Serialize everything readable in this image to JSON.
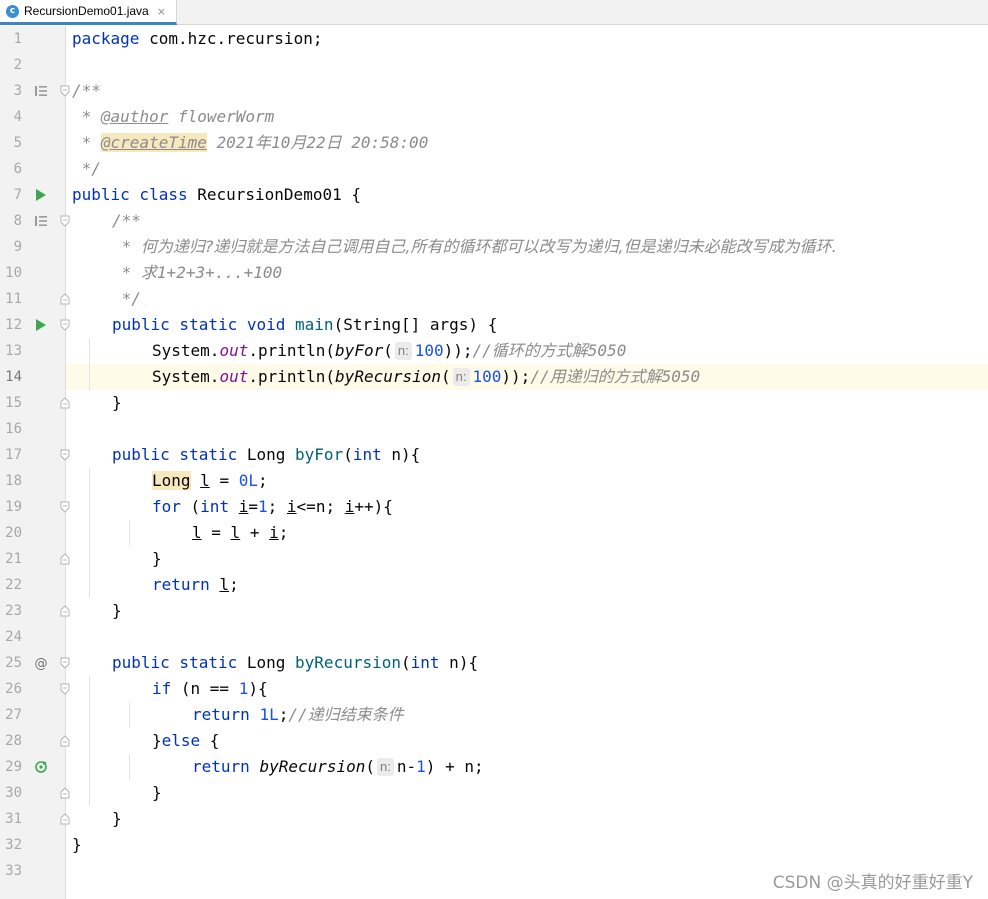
{
  "tab": {
    "file_name": "RecursionDemo01.java",
    "icon": "java-class-icon",
    "close_glyph": "×"
  },
  "editor": {
    "current_line": 14,
    "lines": [
      {
        "n": "1",
        "indent": 0,
        "tokens": [
          [
            "kw",
            "package"
          ],
          [
            "t",
            " com.hzc.recursion;"
          ]
        ]
      },
      {
        "n": "2",
        "indent": 0,
        "tokens": []
      },
      {
        "n": "3",
        "indent": 0,
        "marker": "doc",
        "fold": "start",
        "tokens": [
          [
            "doc",
            "/**"
          ]
        ]
      },
      {
        "n": "4",
        "indent": 0,
        "tokens": [
          [
            "doc",
            " * "
          ],
          [
            "tag",
            "@author"
          ],
          [
            "doc",
            " flowerWorm"
          ]
        ]
      },
      {
        "n": "5",
        "indent": 0,
        "tokens": [
          [
            "doc",
            " * "
          ],
          [
            "tag-hl",
            "@createTime"
          ],
          [
            "doc",
            " 2021"
          ],
          [
            "doc cjk",
            "年"
          ],
          [
            "doc",
            "10"
          ],
          [
            "doc cjk",
            "月"
          ],
          [
            "doc",
            "22"
          ],
          [
            "doc cjk",
            "日"
          ],
          [
            "doc",
            " 20:58:00"
          ]
        ]
      },
      {
        "n": "6",
        "indent": 0,
        "tokens": [
          [
            "doc",
            " */"
          ]
        ]
      },
      {
        "n": "7",
        "indent": 0,
        "marker": "run",
        "tokens": [
          [
            "kw",
            "public class"
          ],
          [
            "t",
            " RecursionDemo01 {"
          ]
        ]
      },
      {
        "n": "8",
        "indent": 1,
        "marker": "doc",
        "fold": "start",
        "tokens": [
          [
            "doc",
            "/**"
          ]
        ]
      },
      {
        "n": "9",
        "indent": 1,
        "tokens": [
          [
            "doc",
            " * "
          ],
          [
            "doc cjk",
            "何为递归?递归就是方法自己调用自己,所有的循环都可以改写为递归,但是递归未必能改写成为循环."
          ]
        ]
      },
      {
        "n": "10",
        "indent": 1,
        "tokens": [
          [
            "doc",
            " * "
          ],
          [
            "doc cjk",
            "求"
          ],
          [
            "doc",
            "1+2+3+...+100"
          ]
        ]
      },
      {
        "n": "11",
        "indent": 1,
        "fold": "end",
        "tokens": [
          [
            "doc",
            " */"
          ]
        ]
      },
      {
        "n": "12",
        "indent": 1,
        "marker": "run",
        "fold": "start",
        "tokens": [
          [
            "kw",
            "public static void"
          ],
          [
            "t",
            " "
          ],
          [
            "meth",
            "main"
          ],
          [
            "t",
            "(String[] args) {"
          ]
        ]
      },
      {
        "n": "13",
        "indent": 2,
        "tokens": [
          [
            "t",
            "System."
          ],
          [
            "static",
            "out"
          ],
          [
            "t",
            ".println("
          ],
          [
            "ital",
            "byFor"
          ],
          [
            "t",
            "("
          ],
          [
            "hint",
            "n:"
          ],
          [
            "num",
            "100"
          ],
          [
            "t",
            "));"
          ],
          [
            "cmt",
            "//"
          ],
          [
            "cmt cjk",
            "循环的方式解"
          ],
          [
            "cmt",
            "5050"
          ]
        ]
      },
      {
        "n": "14",
        "indent": 2,
        "tokens": [
          [
            "t",
            "System."
          ],
          [
            "static",
            "out"
          ],
          [
            "t",
            ".println("
          ],
          [
            "ital",
            "byRecursion"
          ],
          [
            "t",
            "("
          ],
          [
            "hint",
            "n:"
          ],
          [
            "num",
            "100"
          ],
          [
            "t",
            "));"
          ],
          [
            "cmt",
            "//"
          ],
          [
            "cmt cjk",
            "用递归的方式解"
          ],
          [
            "cmt",
            "5050"
          ]
        ]
      },
      {
        "n": "15",
        "indent": 1,
        "fold": "end",
        "tokens": [
          [
            "t",
            "}"
          ]
        ]
      },
      {
        "n": "16",
        "indent": 0,
        "tokens": []
      },
      {
        "n": "17",
        "indent": 1,
        "fold": "start",
        "tokens": [
          [
            "kw",
            "public static"
          ],
          [
            "t",
            " Long "
          ],
          [
            "meth",
            "byFor"
          ],
          [
            "t",
            "("
          ],
          [
            "kw",
            "int"
          ],
          [
            "t",
            " n){"
          ]
        ]
      },
      {
        "n": "18",
        "indent": 2,
        "tokens": [
          [
            "hlref",
            "Long"
          ],
          [
            "t",
            " "
          ],
          [
            "uline",
            "l"
          ],
          [
            "t",
            " = "
          ],
          [
            "num",
            "0L"
          ],
          [
            "t",
            ";"
          ]
        ]
      },
      {
        "n": "19",
        "indent": 2,
        "fold": "start",
        "tokens": [
          [
            "kw",
            "for"
          ],
          [
            "t",
            " ("
          ],
          [
            "kw",
            "int"
          ],
          [
            "t",
            " "
          ],
          [
            "uline",
            "i"
          ],
          [
            "t",
            "="
          ],
          [
            "num",
            "1"
          ],
          [
            "t",
            "; "
          ],
          [
            "uline",
            "i"
          ],
          [
            "t",
            "<=n; "
          ],
          [
            "uline",
            "i"
          ],
          [
            "t",
            "++){"
          ]
        ]
      },
      {
        "n": "20",
        "indent": 3,
        "tokens": [
          [
            "uline",
            "l"
          ],
          [
            "t",
            " = "
          ],
          [
            "uline",
            "l"
          ],
          [
            "t",
            " + "
          ],
          [
            "uline",
            "i"
          ],
          [
            "t",
            ";"
          ]
        ]
      },
      {
        "n": "21",
        "indent": 2,
        "fold": "end",
        "tokens": [
          [
            "t",
            "}"
          ]
        ]
      },
      {
        "n": "22",
        "indent": 2,
        "tokens": [
          [
            "kw",
            "return"
          ],
          [
            "t",
            " "
          ],
          [
            "uline",
            "l"
          ],
          [
            "t",
            ";"
          ]
        ]
      },
      {
        "n": "23",
        "indent": 1,
        "fold": "end",
        "tokens": [
          [
            "t",
            "}"
          ]
        ]
      },
      {
        "n": "24",
        "indent": 0,
        "tokens": []
      },
      {
        "n": "25",
        "indent": 1,
        "marker": "at",
        "fold": "start",
        "tokens": [
          [
            "kw",
            "public static"
          ],
          [
            "t",
            " Long "
          ],
          [
            "meth",
            "byRecursion"
          ],
          [
            "t",
            "("
          ],
          [
            "kw",
            "int"
          ],
          [
            "t",
            " n){"
          ]
        ]
      },
      {
        "n": "26",
        "indent": 2,
        "fold": "start",
        "tokens": [
          [
            "kw",
            "if"
          ],
          [
            "t",
            " (n == "
          ],
          [
            "num",
            "1"
          ],
          [
            "t",
            "){"
          ]
        ]
      },
      {
        "n": "27",
        "indent": 3,
        "tokens": [
          [
            "kw",
            "return"
          ],
          [
            "t",
            " "
          ],
          [
            "num",
            "1L"
          ],
          [
            "t",
            ";"
          ],
          [
            "cmt",
            "//"
          ],
          [
            "cmt cjk",
            "递归结束条件"
          ]
        ]
      },
      {
        "n": "28",
        "indent": 2,
        "fold": "mid",
        "tokens": [
          [
            "t",
            "}"
          ],
          [
            "kw",
            "else"
          ],
          [
            "t",
            " {"
          ]
        ]
      },
      {
        "n": "29",
        "indent": 3,
        "marker": "recursive",
        "tokens": [
          [
            "kw",
            "return"
          ],
          [
            "t",
            " "
          ],
          [
            "ital",
            "byRecursion"
          ],
          [
            "t",
            "("
          ],
          [
            "hint",
            "n:"
          ],
          [
            "t",
            "n-"
          ],
          [
            "num",
            "1"
          ],
          [
            "t",
            ") + n;"
          ]
        ]
      },
      {
        "n": "30",
        "indent": 2,
        "fold": "end",
        "tokens": [
          [
            "t",
            "}"
          ]
        ]
      },
      {
        "n": "31",
        "indent": 1,
        "fold": "end",
        "tokens": [
          [
            "t",
            "}"
          ]
        ]
      },
      {
        "n": "32",
        "indent": 0,
        "tokens": [
          [
            "t",
            "}"
          ]
        ]
      },
      {
        "n": "33",
        "indent": 0,
        "tokens": []
      }
    ]
  },
  "watermark": "CSDN @头真的好重好重Y"
}
